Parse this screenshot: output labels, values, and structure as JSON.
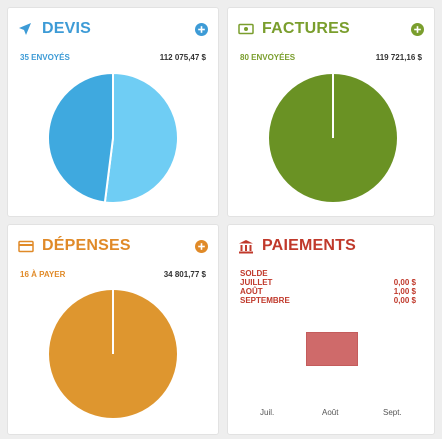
{
  "colors": {
    "devis": "#3d9bd6",
    "factures": "#7a9e2d",
    "depenses": "#e08a28",
    "paiements": "#c0392b",
    "pie_devis_a": "#3fa9df",
    "pie_devis_b": "#6fcdf4",
    "pie_factures": "#6a9224",
    "pie_depenses": "#de962f",
    "bar": "#cf6a6a"
  },
  "devis": {
    "title": "DEVIS",
    "icon": "paper-plane-icon",
    "status": "35 ENVOYÉS",
    "amount": "112 075,47 $",
    "slices": [
      0.52,
      0.48
    ]
  },
  "factures": {
    "title": "FACTURES",
    "icon": "banknote-icon",
    "status": "80 ENVOYÉES",
    "amount": "119 721,16 $",
    "slices": [
      1.0
    ]
  },
  "depenses": {
    "title": "DÉPENSES",
    "icon": "credit-card-icon",
    "status": "16 À PAYER",
    "amount": "34 801,77 $",
    "slices": [
      1.0
    ]
  },
  "paiements": {
    "title": "PAIEMENTS",
    "icon": "bank-icon",
    "solde_label": "SOLDE",
    "rows": [
      {
        "month": "JUILLET",
        "amount": "0,00 $"
      },
      {
        "month": "AOÛT",
        "amount": "1,00 $"
      },
      {
        "month": "SEPTEMBRE",
        "amount": "0,00 $"
      }
    ],
    "axis": [
      "Juil.",
      "Août",
      "Sept."
    ]
  }
}
